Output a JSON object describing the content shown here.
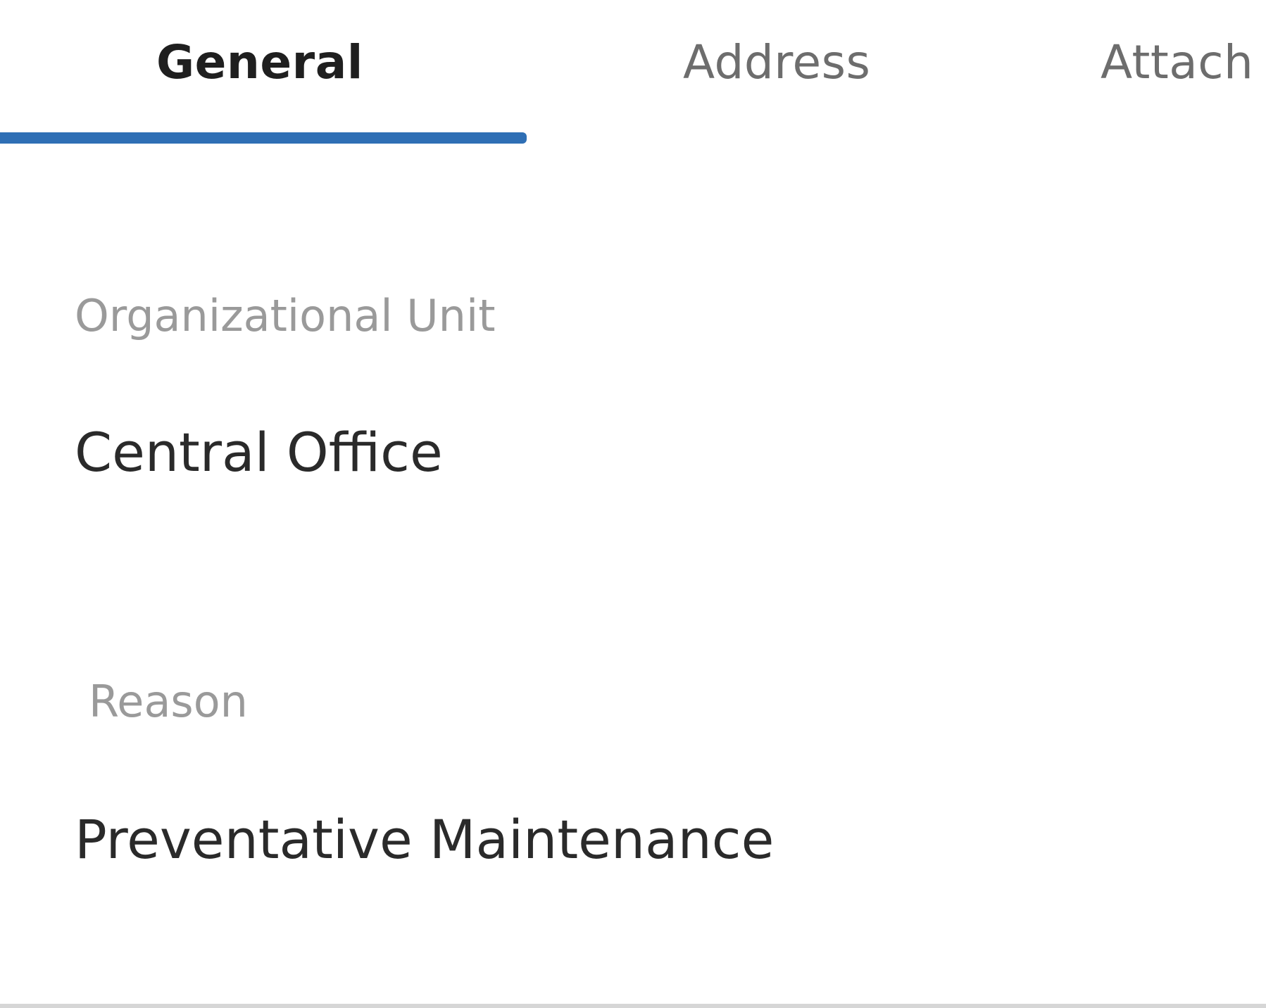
{
  "tabs": [
    {
      "label": "General",
      "active": true
    },
    {
      "label": "Address",
      "active": false
    },
    {
      "label": "Attach",
      "active": false
    }
  ],
  "fields": {
    "organizational_unit": {
      "label": "Organizational Unit",
      "value": "Central Office"
    },
    "reason": {
      "label": "Reason",
      "value": "Preventative Maintenance"
    }
  },
  "colors": {
    "accent": "#2f6fb5",
    "label_text": "#9a9a9a",
    "value_text": "#2a2a2a",
    "inactive_tab": "#6d6d6d"
  }
}
